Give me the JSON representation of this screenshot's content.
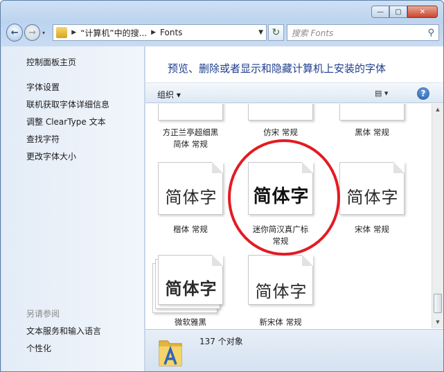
{
  "window": {
    "close_label": "✕",
    "max_label": "▢",
    "min_label": "—"
  },
  "nav": {
    "back_icon": "←",
    "forward_icon": "→",
    "recent_icon": "▾",
    "breadcrumb": [
      "“计算机”中的搜...",
      "Fonts"
    ],
    "refresh_icon": "↻",
    "search_placeholder": "搜索 Fonts",
    "search_icon": "⚲"
  },
  "sidebar": {
    "home": "控制面板主页",
    "links": [
      "字体设置",
      "联机获取字体详细信息",
      "调整 ClearType 文本",
      "查找字符",
      "更改字体大小"
    ],
    "see_also_heading": "另请参阅",
    "see_also": [
      "文本服务和输入语言",
      "个性化"
    ]
  },
  "main": {
    "title": "预览、删除或者显示和隐藏计算机上安装的字体",
    "organize_label": "组织 ▾",
    "view_label": "▤ ▾",
    "help_label": "?"
  },
  "fonts": [
    {
      "name": "方正兰亭超细黑",
      "sub": "简体 常规",
      "glyph": ""
    },
    {
      "name": "仿宋 常规",
      "sub": "",
      "glyph": ""
    },
    {
      "name": "黑体 常规",
      "sub": "",
      "glyph": ""
    },
    {
      "name": "楷体 常规",
      "sub": "",
      "glyph": "简体字"
    },
    {
      "name": "迷你简汉真广标",
      "sub": "常规",
      "glyph": "简体字"
    },
    {
      "name": "宋体 常规",
      "sub": "",
      "glyph": "简体字"
    },
    {
      "name": "微软雅黑",
      "sub": "",
      "glyph": "简体字"
    },
    {
      "name": "新宋体 常规",
      "sub": "",
      "glyph": "简体字"
    }
  ],
  "status": {
    "count": "137 个对象"
  },
  "colors": {
    "title": "#1e3e8c",
    "highlight_circle": "#e31b23",
    "sidebar_bg": "#e3ecf7"
  }
}
